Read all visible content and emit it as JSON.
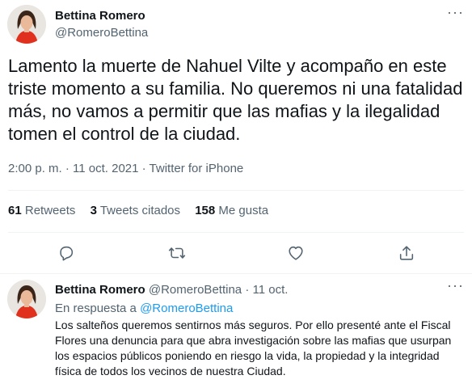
{
  "main_tweet": {
    "author_name": "Bettina Romero",
    "author_handle": "@RomeroBettina",
    "text": "Lamento la muerte de Nahuel Vilte y acompaño en este triste momento a su familia. No queremos ni una fatalidad más, no vamos a permitir que las mafias y la ilegalidad tomen el control de la ciudad.",
    "timestamp": "2:00 p. m. · 11 oct. 2021 · Twitter for iPhone",
    "stats": {
      "retweets_count": "61",
      "retweets_label": "Retweets",
      "quotes_count": "3",
      "quotes_label": "Tweets citados",
      "likes_count": "158",
      "likes_label": "Me gusta"
    }
  },
  "action_icons": [
    "reply-icon",
    "retweet-icon",
    "like-icon",
    "share-icon"
  ],
  "reply_tweet": {
    "author_name": "Bettina Romero",
    "author_handle": "@RomeroBettina",
    "separator": "·",
    "date": "11 oct.",
    "reply_prefix": "En respuesta a",
    "reply_to_handle": "@RomeroBettina",
    "text": "Los salteños queremos sentirnos más seguros. Por ello presenté ante el Fiscal Flores una denuncia para que abra investigación sobre las mafias que usurpan los espacios públicos poniendo en riesgo la vida, la propiedad y la integridad física de todos los vecinos de nuestra Ciudad."
  },
  "colors": {
    "text_primary": "#0f1419",
    "text_secondary": "#536471",
    "accent": "#1d9bf0",
    "divider": "#eff3f4"
  }
}
